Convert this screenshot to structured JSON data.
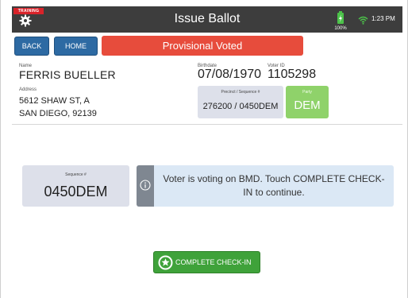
{
  "header": {
    "training_badge": "TRAINING",
    "title": "Issue Ballot",
    "battery": "100%",
    "time": "1:23 PM"
  },
  "toolbar": {
    "back_label": "BACK",
    "home_label": "HOME",
    "status": "Provisional Voted"
  },
  "voter": {
    "name_label": "Name",
    "name": "FERRIS BUELLER",
    "address_label": "Address",
    "address_line1": "5612 SHAW ST, A",
    "address_line2": "SAN DIEGO, 92139",
    "birthdate_label": "Birthdate",
    "birthdate": "07/08/1970",
    "voter_id_label": "Voter ID",
    "voter_id": "1105298",
    "precinct_label": "Precinct / Sequence #",
    "precinct": "276200 / 0450DEM",
    "party_label": "Party",
    "party": "DEM"
  },
  "sequence": {
    "label": "Sequence #",
    "value": "0450DEM"
  },
  "message": {
    "text": "Voter is voting on BMD. Touch COMPLETE CHECK-IN to continue."
  },
  "actions": {
    "complete_label": "COMPLETE CHECK-IN"
  },
  "colors": {
    "header_bg": "#3d3d3d",
    "status_red": "#e74c3c",
    "button_blue": "#2d6aa3",
    "party_green": "#8fd26a",
    "complete_green": "#3fa23a"
  },
  "icons": [
    "gear-icon",
    "battery-icon",
    "wifi-icon",
    "info-icon",
    "star-icon"
  ]
}
